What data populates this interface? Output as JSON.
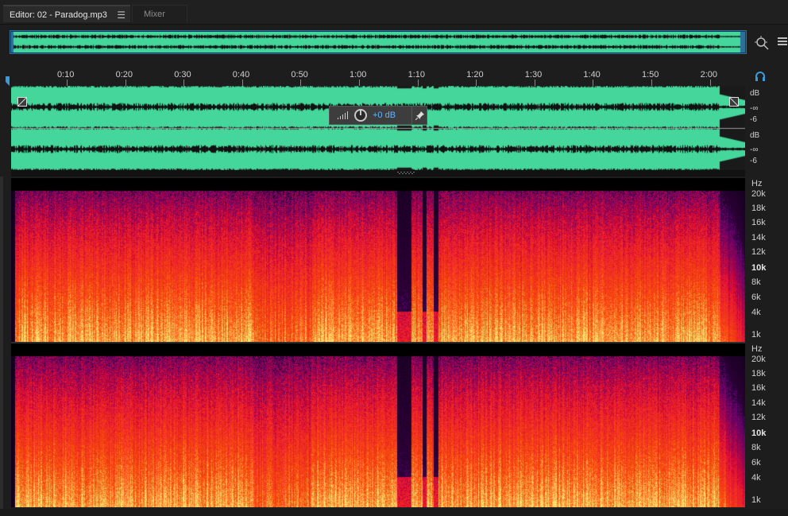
{
  "tabs": {
    "editor_label": "Editor: 02 - Paradog.mp3",
    "mixer_label": "Mixer"
  },
  "ruler": {
    "unit": "hms",
    "ticks": [
      "0:10",
      "0:20",
      "0:30",
      "0:40",
      "0:50",
      "1:00",
      "1:10",
      "1:20",
      "1:30",
      "1:40",
      "1:50",
      "2:00"
    ]
  },
  "hud": {
    "volume": "+0 dB"
  },
  "db_scale": {
    "unit": "dB",
    "levels": [
      "-∞",
      "-6"
    ]
  },
  "hz_scale": {
    "unit": "Hz",
    "labels": [
      "20k",
      "18k",
      "16k",
      "14k",
      "12k",
      "10k",
      "8k",
      "6k",
      "4k",
      "1k"
    ],
    "bold_label": "10k"
  },
  "colors": {
    "waveform": "#44d69a",
    "accent": "#3a9bd9",
    "spectrogram_low": "#ffe878",
    "spectrogram_high": "#3a0a55"
  },
  "icons": [
    "menu-icon",
    "zoom-icon",
    "list-icon",
    "playhead-marker-icon",
    "headphone-icon",
    "fade-in-icon",
    "fade-out-icon",
    "level-icon",
    "volume-knob-icon",
    "pin-icon"
  ]
}
